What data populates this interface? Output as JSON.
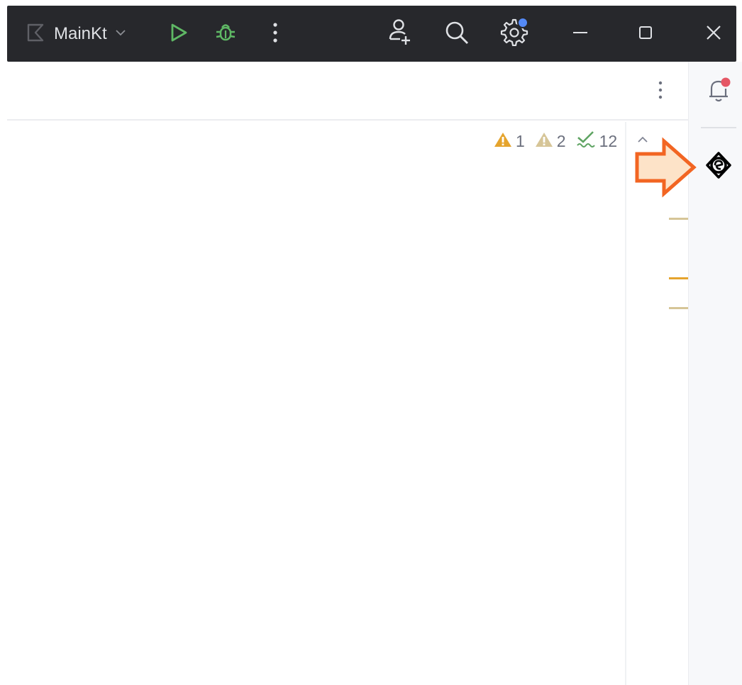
{
  "titlebar": {
    "run_config": {
      "label": "MainKt",
      "icon": "kotlin-file-icon"
    },
    "actions": [
      {
        "name": "run-button",
        "icon": "play-icon"
      },
      {
        "name": "debug-button",
        "icon": "bug-icon"
      },
      {
        "name": "more-actions-button",
        "icon": "more-vertical-icon"
      },
      {
        "name": "code-with-me-button",
        "icon": "add-user-icon"
      },
      {
        "name": "search-everywhere-button",
        "icon": "search-icon"
      },
      {
        "name": "settings-button",
        "icon": "gear-icon",
        "badge": true
      },
      {
        "name": "minimize-button",
        "icon": "minimize-icon"
      },
      {
        "name": "maximize-button",
        "icon": "square-icon"
      },
      {
        "name": "close-window-button",
        "icon": "close-icon"
      }
    ]
  },
  "inspections": {
    "errors": {
      "count": "1",
      "icon": "warning-icon",
      "color": "#e5a42d"
    },
    "weak_warnings": {
      "count": "2",
      "icon": "warning-icon",
      "color": "#d6c597"
    },
    "typos": {
      "count": "12",
      "icon": "typo-check-icon",
      "color": "#5fa463"
    }
  },
  "right_toolwindow": {
    "items": [
      {
        "name": "notifications",
        "icon": "bell-icon",
        "badge_color": "#e55765"
      },
      {
        "name": "ai-assistant",
        "icon": "ai-assistant-icon"
      }
    ]
  },
  "colors": {
    "titlebar_bg": "#27282c",
    "run_green": "#5fb865",
    "badge_blue": "#548af7",
    "callout_orange": "#f26522",
    "callout_fill": "#fde3c8"
  }
}
